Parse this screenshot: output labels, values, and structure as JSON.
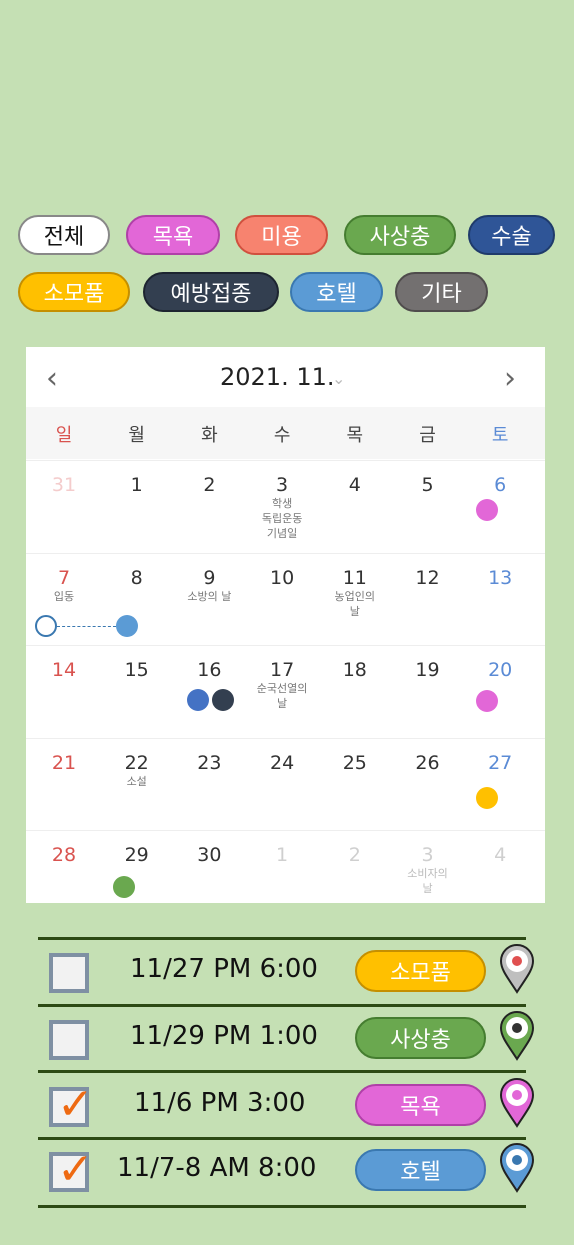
{
  "categories": [
    {
      "label": "전체",
      "bg": "#ffffff",
      "border": "#888888",
      "color": "#111111"
    },
    {
      "label": "목욕",
      "bg": "#e267d7",
      "border": "#b040a8",
      "color": "#ffffff"
    },
    {
      "label": "미용",
      "bg": "#f7836f",
      "border": "#d0503e",
      "color": "#ffffff"
    },
    {
      "label": "사상충",
      "bg": "#6aa84f",
      "border": "#457d30",
      "color": "#ffffff"
    },
    {
      "label": "수술",
      "bg": "#2f5597",
      "border": "#1f3b6b",
      "color": "#ffffff"
    },
    {
      "label": "소모품",
      "bg": "#ffc000",
      "border": "#c58f00",
      "color": "#ffffff"
    },
    {
      "label": "예방접종",
      "bg": "#333f50",
      "border": "#1d2530",
      "color": "#ffffff"
    },
    {
      "label": "호텔",
      "bg": "#5b9bd5",
      "border": "#3a78b0",
      "color": "#ffffff"
    },
    {
      "label": "기타",
      "bg": "#737070",
      "border": "#4f4c4c",
      "color": "#ffffff"
    }
  ],
  "calendar": {
    "title": "2021. 11.",
    "prev_icon": "chevron-left-icon",
    "next_icon": "chevron-right-icon",
    "weekdays": [
      "일",
      "월",
      "화",
      "수",
      "목",
      "금",
      "토"
    ],
    "weeks": [
      [
        {
          "n": "31",
          "t": "other"
        },
        {
          "n": "1"
        },
        {
          "n": "2"
        },
        {
          "n": "3",
          "sub": "학생\n독립운동\n기념일"
        },
        {
          "n": "4"
        },
        {
          "n": "5"
        },
        {
          "n": "6"
        }
      ],
      [
        {
          "n": "7",
          "sub": "입동"
        },
        {
          "n": "8"
        },
        {
          "n": "9",
          "sub": "소방의 날"
        },
        {
          "n": "10"
        },
        {
          "n": "11",
          "sub": "농업인의\n날"
        },
        {
          "n": "12"
        },
        {
          "n": "13"
        }
      ],
      [
        {
          "n": "14"
        },
        {
          "n": "15"
        },
        {
          "n": "16"
        },
        {
          "n": "17",
          "sub": "순국선열의\n날"
        },
        {
          "n": "18"
        },
        {
          "n": "19"
        },
        {
          "n": "20"
        }
      ],
      [
        {
          "n": "21"
        },
        {
          "n": "22",
          "sub": "소설"
        },
        {
          "n": "23"
        },
        {
          "n": "24"
        },
        {
          "n": "25"
        },
        {
          "n": "26"
        },
        {
          "n": "27"
        }
      ],
      [
        {
          "n": "28"
        },
        {
          "n": "29"
        },
        {
          "n": "30"
        },
        {
          "n": "1",
          "t": "other"
        },
        {
          "n": "2",
          "t": "other"
        },
        {
          "n": "3",
          "t": "other",
          "sub": "소비자의\n날"
        },
        {
          "n": "4",
          "t": "other"
        }
      ]
    ]
  },
  "events": [
    {
      "date_time": "11/27 PM 6:00",
      "category": "소모품",
      "checked": false,
      "pill_bg": "#ffc000",
      "pill_border": "#c58f00",
      "pin": "shop-pin-icon"
    },
    {
      "date_time": "11/29 PM 1:00",
      "category": "사상충",
      "checked": false,
      "pill_bg": "#6aa84f",
      "pill_border": "#457d30",
      "pin": "vet-pin-icon"
    },
    {
      "date_time": "11/6  PM 3:00",
      "category": "목욕",
      "checked": true,
      "pill_bg": "#e267d7",
      "pill_border": "#b040a8",
      "pin": "bath-pin-icon"
    },
    {
      "date_time": "11/7-8  AM 8:00",
      "category": "호텔",
      "checked": true,
      "pill_bg": "#5b9bd5",
      "pill_border": "#3a78b0",
      "pin": "hotel-pin-icon"
    }
  ]
}
